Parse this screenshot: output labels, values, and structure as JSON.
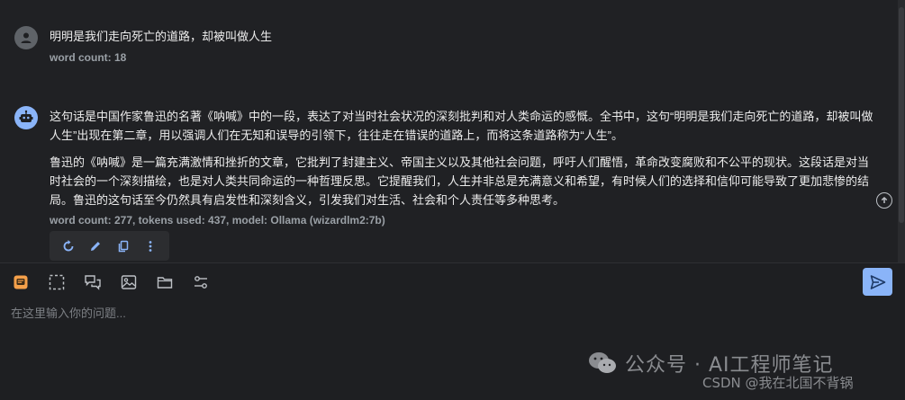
{
  "user_message": {
    "text": "明明是我们走向死亡的道路，却被叫做人生",
    "meta": "word count: 18"
  },
  "assistant_message": {
    "paragraphs": [
      "这句话是中国作家鲁迅的名著《呐喊》中的一段，表达了对当时社会状况的深刻批判和对人类命运的感慨。全书中，这句“明明是我们走向死亡的道路，却被叫做人生”出现在第二章，用以强调人们在无知和误导的引领下，往往走在错误的道路上，而将这条道路称为“人生”。",
      "鲁迅的《呐喊》是一篇充满激情和挫折的文章，它批判了封建主义、帝国主义以及其他社会问题，呼吁人们醒悟，革命改变腐败和不公平的现状。这段话是对当时社会的一个深刻描绘，也是对人类共同命运的一种哲理反思。它提醒我们，人生并非总是充满意义和希望，有时候人们的选择和信仰可能导致了更加悲惨的结局。鲁迅的这句话至今仍然具有启发性和深刻含义，引发我们对生活、社会和个人责任等多种思考。"
    ],
    "meta": "word count: 277, tokens used: 437, model: Ollama (wizardlm2:7b)"
  },
  "message_actions": [
    "regenerate-icon",
    "edit-icon",
    "copy-icon",
    "more-icon"
  ],
  "composer": {
    "tools": [
      "model-icon",
      "select-area-icon",
      "chat-bubbles-icon",
      "image-icon",
      "folder-icon",
      "settings-sliders-icon"
    ],
    "placeholder": "在这里输入你的问题...",
    "send_icon": "send-icon"
  },
  "watermark": {
    "text": "公众号 · AI工程师笔记",
    "csdn": "CSDN @我在北国不背锅"
  },
  "colors": {
    "background": "#202124",
    "composer_bg": "#1e1f22",
    "accent": "#8ab4f8",
    "text": "#ececec",
    "muted": "#9aa0a6"
  }
}
